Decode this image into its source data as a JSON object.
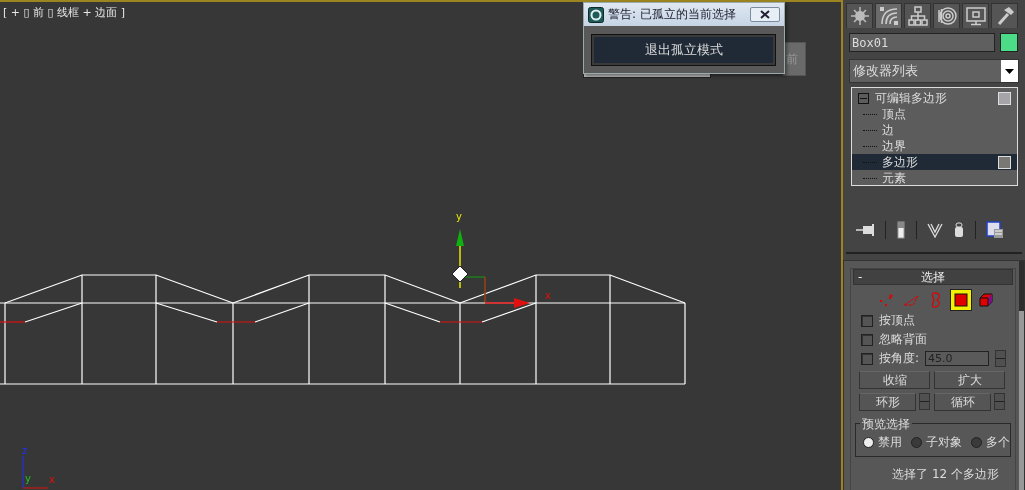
{
  "viewport": {
    "label": "[ + ▯ 前 ▯ 线框 + 边面 ]",
    "active": true,
    "gizmo_axes": [
      "y",
      "x"
    ],
    "corner_axes": [
      "z",
      "y",
      "x"
    ],
    "viewcube_label": "前"
  },
  "dialog": {
    "title": "警告: 已孤立的当前选择",
    "button": "退出孤立模式"
  },
  "command_panel": {
    "tabs": [
      {
        "kind": "create",
        "selected": false
      },
      {
        "kind": "modify",
        "selected": true
      },
      {
        "kind": "hierarchy",
        "selected": false
      },
      {
        "kind": "motion",
        "selected": false
      },
      {
        "kind": "display",
        "selected": false
      },
      {
        "kind": "utilities",
        "selected": false
      }
    ],
    "object": {
      "name": "Box01",
      "color": "#4cdc88"
    },
    "modifier_list": "修改器列表",
    "stack": {
      "label": "可编辑多边形",
      "expanded": true,
      "children": [
        {
          "label": "顶点",
          "selected": false
        },
        {
          "label": "边",
          "selected": false
        },
        {
          "label": "边界",
          "selected": false
        },
        {
          "label": "多边形",
          "selected": true
        },
        {
          "label": "元素",
          "selected": false
        }
      ]
    },
    "rollout": {
      "collapse": "-",
      "title": "选择",
      "subobjects": [
        {
          "kind": "vertex",
          "selected": false
        },
        {
          "kind": "edge",
          "selected": false
        },
        {
          "kind": "border",
          "selected": false
        },
        {
          "kind": "polygon",
          "selected": true
        },
        {
          "kind": "element",
          "selected": false
        }
      ],
      "options": [
        {
          "label": "按顶点",
          "checked": false
        },
        {
          "label": "忽略背面",
          "checked": false
        },
        {
          "label": "按角度:",
          "checked": false,
          "value": "45.0"
        }
      ],
      "buttons": [
        {
          "label": "收缩",
          "kind": "plain"
        },
        {
          "label": "扩大",
          "kind": "plain"
        },
        {
          "label": "环形",
          "kind": "spinner"
        },
        {
          "label": "循环",
          "kind": "spinner"
        }
      ],
      "preview": {
        "title": "预览选择",
        "options": [
          {
            "label": "禁用",
            "selected": true
          },
          {
            "label": "子对象",
            "selected": false
          },
          {
            "label": "多个",
            "selected": false
          }
        ]
      },
      "status": "选择了 12 个多边形"
    }
  }
}
